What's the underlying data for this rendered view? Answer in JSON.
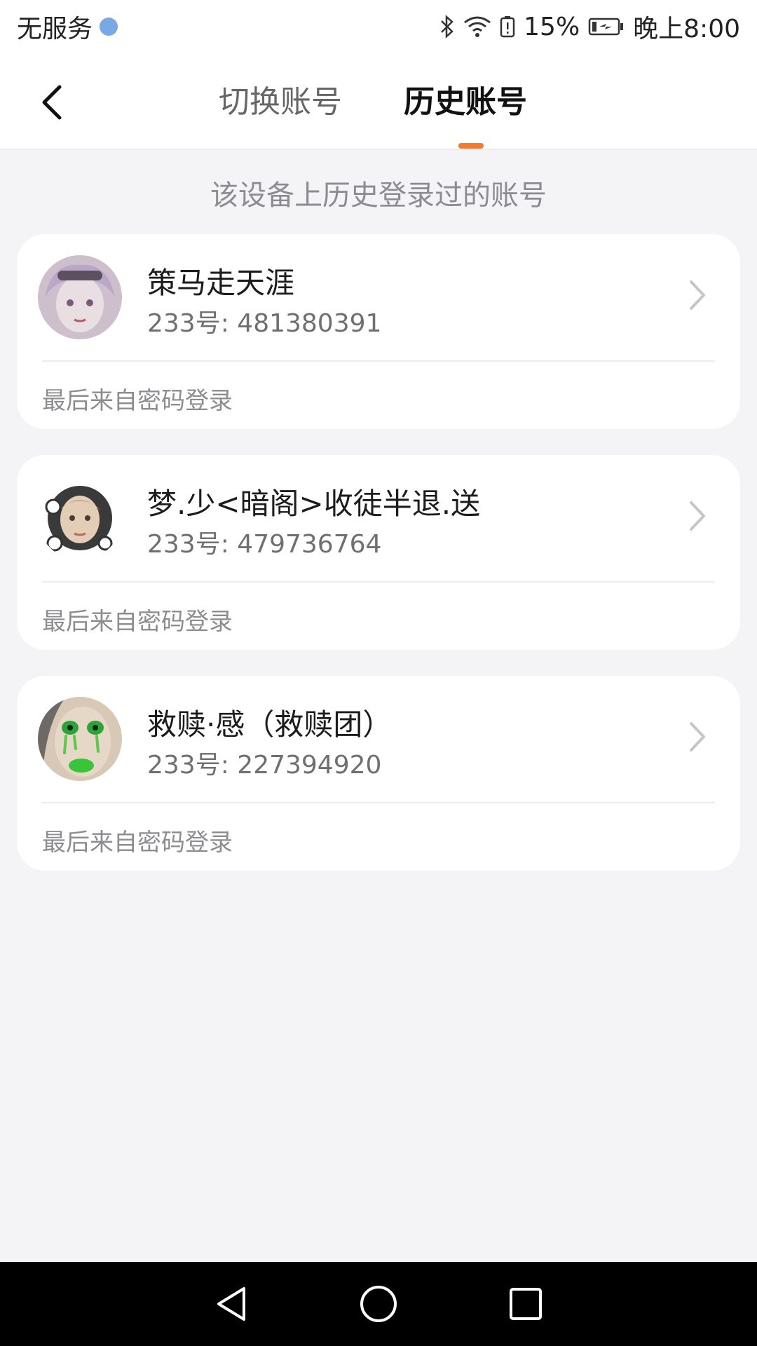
{
  "status": {
    "carrier": "无服务",
    "battery": "15%",
    "time": "晚上8:00"
  },
  "header": {
    "tabs": [
      {
        "label": "切换账号",
        "active": false
      },
      {
        "label": "历史账号",
        "active": true
      }
    ],
    "accent_color": "#f07a2e"
  },
  "subtitle": "该设备上历史登录过的账号",
  "accounts": [
    {
      "name": "策马走天涯",
      "id": "233号: 481380391",
      "source": "最后来自密码登录"
    },
    {
      "name": "梦.少<暗阁>收徒半退.送",
      "id": "233号: 479736764",
      "source": "最后来自密码登录"
    },
    {
      "name": "救赎·感（救赎团）",
      "id": "233号: 227394920",
      "source": "最后来自密码登录"
    }
  ],
  "icons": {
    "back": "chevron-left-icon",
    "row": "chevron-right-icon",
    "nav_back": "triangle-back-icon",
    "nav_home": "circle-home-icon",
    "nav_recent": "square-recent-icon"
  }
}
